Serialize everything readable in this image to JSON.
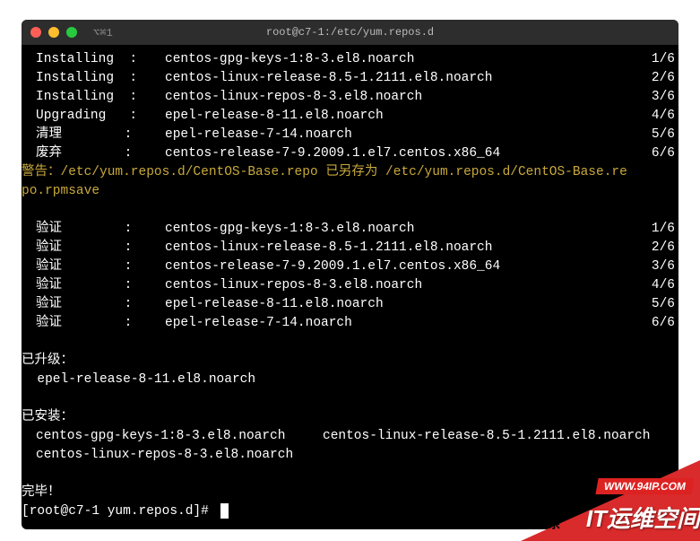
{
  "titlebar": {
    "tab_label": "⌥⌘1",
    "title": "root@c7-1:/etc/yum.repos.d"
  },
  "transactions": [
    {
      "action": "Installing",
      "pkg": "centos-gpg-keys-1:8-3.el8.noarch",
      "count": "1/6"
    },
    {
      "action": "Installing",
      "pkg": "centos-linux-release-8.5-1.2111.el8.noarch",
      "count": "2/6"
    },
    {
      "action": "Installing",
      "pkg": "centos-linux-repos-8-3.el8.noarch",
      "count": "3/6"
    },
    {
      "action": "Upgrading",
      "pkg": "epel-release-8-11.el8.noarch",
      "count": "4/6"
    },
    {
      "action": "清理",
      "pkg": "epel-release-7-14.noarch",
      "count": "5/6"
    },
    {
      "action": "废弃",
      "pkg": "centos-release-7-9.2009.1.el7.centos.x86_64",
      "count": "6/6"
    }
  ],
  "warning_line1": "警告：/etc/yum.repos.d/CentOS-Base.repo 已另存为 /etc/yum.repos.d/CentOS-Base.re",
  "warning_line2": "po.rpmsave",
  "verifications": [
    {
      "action": "验证",
      "pkg": "centos-gpg-keys-1:8-3.el8.noarch",
      "count": "1/6"
    },
    {
      "action": "验证",
      "pkg": "centos-linux-release-8.5-1.2111.el8.noarch",
      "count": "2/6"
    },
    {
      "action": "验证",
      "pkg": "centos-release-7-9.2009.1.el7.centos.x86_64",
      "count": "3/6"
    },
    {
      "action": "验证",
      "pkg": "centos-linux-repos-8-3.el8.noarch",
      "count": "4/6"
    },
    {
      "action": "验证",
      "pkg": "epel-release-8-11.el8.noarch",
      "count": "5/6"
    },
    {
      "action": "验证",
      "pkg": "epel-release-7-14.noarch",
      "count": "6/6"
    }
  ],
  "upgraded_header": "已升级：",
  "upgraded_pkg": "  epel-release-8-11.el8.noarch",
  "installed_header": "已安装：",
  "installed_row1_a": "centos-gpg-keys-1:8-3.el8.noarch",
  "installed_row1_b": "centos-linux-release-8.5-1.2111.el8.noarch",
  "installed_row2_a": "centos-linux-repos-8-3.el8.noarch",
  "complete": "完毕！",
  "prompt": "[root@c7-1 yum.repos.d]# ",
  "watermark": {
    "url": "WWW.94IP.COM",
    "text": "IT运维空间",
    "prefix": "头条"
  }
}
